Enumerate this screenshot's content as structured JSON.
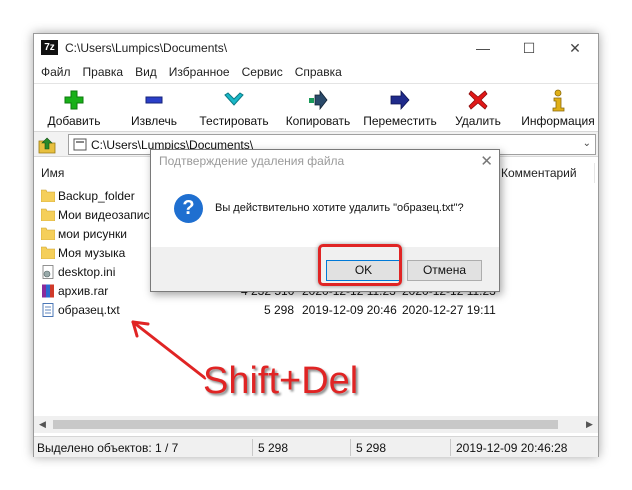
{
  "window": {
    "title": "C:\\Users\\Lumpics\\Documents\\",
    "minimize_glyph": "—",
    "maximize_glyph": "☐",
    "close_glyph": "✕",
    "app_icon": "7z"
  },
  "menu": [
    "Файл",
    "Правка",
    "Вид",
    "Избранное",
    "Сервис",
    "Справка"
  ],
  "toolbar": {
    "add": "Добавить",
    "extract": "Извлечь",
    "test": "Тестировать",
    "copy": "Копировать",
    "move": "Переместить",
    "delete": "Удалить",
    "info": "Информация"
  },
  "address": {
    "path": "C:\\Users\\Lumpics\\Documents\\",
    "chevron": "⌄"
  },
  "columns": {
    "name": "Имя",
    "comment": "Комментарий"
  },
  "files": [
    {
      "name": "Backup_folder",
      "type": "folder",
      "size": "",
      "modified": "",
      "created": ""
    },
    {
      "name": "Мои видеозаписи",
      "type": "folder",
      "size": "",
      "modified": "",
      "created": ""
    },
    {
      "name": "мои рисунки",
      "type": "folder",
      "size": "",
      "modified": "",
      "created": ""
    },
    {
      "name": "Моя музыка",
      "type": "folder",
      "size": "",
      "modified": "",
      "created": ""
    },
    {
      "name": "desktop.ini",
      "type": "ini",
      "size": "",
      "modified": "",
      "created": ""
    },
    {
      "name": "архив.rar",
      "type": "rar",
      "size": "4 232 510",
      "modified": "2020-12-12 11:23",
      "created": "2020-12-12 11:23"
    },
    {
      "name": "образец.txt",
      "type": "txt",
      "size": "5 298",
      "modified": "2019-12-09 20:46",
      "created": "2020-12-27 19:11"
    }
  ],
  "status": {
    "selected": "Выделено объектов: 1 / 7",
    "size": "5 298",
    "packed": "5 298",
    "date": "2019-12-09 20:46:28"
  },
  "dialog": {
    "title": "Подтверждение удаления файла",
    "message": "Вы действительно хотите удалить \"образец.txt\"?",
    "question_glyph": "?",
    "close_glyph": "✕",
    "ok": "OK",
    "cancel": "Отмена"
  },
  "annotation": {
    "text": "Shift+Del",
    "color": "#e02424"
  },
  "icons": {
    "add": "plus-icon",
    "extract": "minus-icon",
    "test": "check-icon",
    "copy": "copy-arrow-icon",
    "move": "move-arrow-icon",
    "delete": "x-icon",
    "info": "info-icon"
  }
}
